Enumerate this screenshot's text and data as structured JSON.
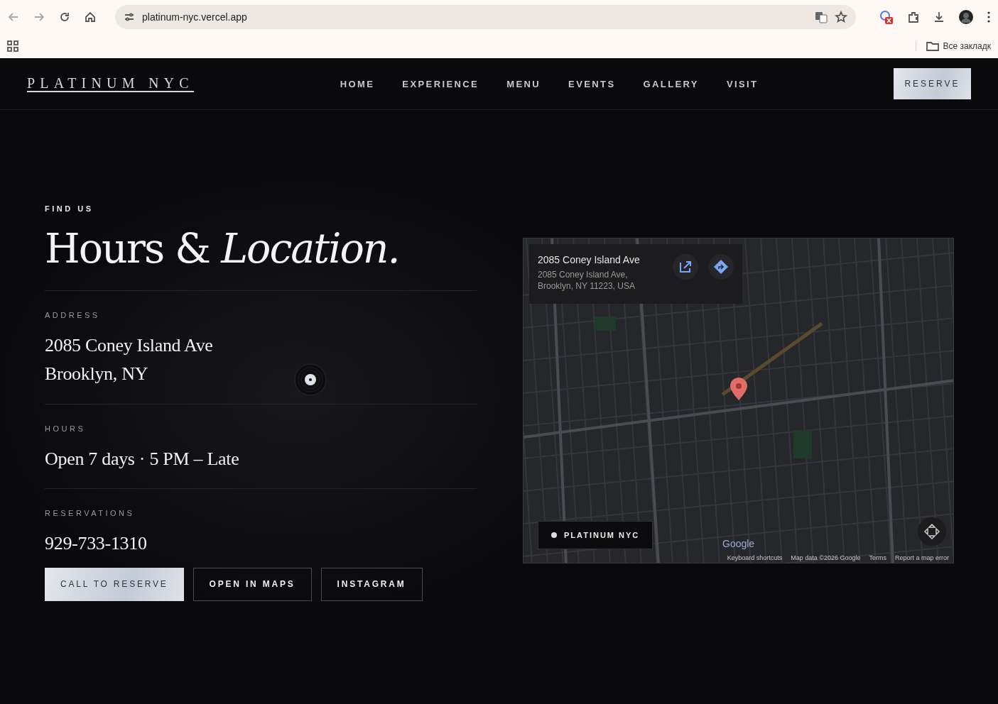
{
  "browser": {
    "url": "platinum-nyc.vercel.app",
    "bookmarks_label": "Все закладк"
  },
  "nav": {
    "logo": "PLATINUM NYC",
    "links": [
      {
        "label": "HOME"
      },
      {
        "label": "EXPERIENCE"
      },
      {
        "label": "MENU"
      },
      {
        "label": "EVENTS"
      },
      {
        "label": "GALLERY"
      },
      {
        "label": "VISIT"
      }
    ],
    "reserve": "RESERVE"
  },
  "section": {
    "eyebrow": "FIND US",
    "heading": "Hours & *Location.*",
    "blocks": [
      {
        "label": "ADDRESS",
        "lines": [
          "2085 Coney Island Ave",
          "Brooklyn, NY"
        ]
      },
      {
        "label": "HOURS",
        "lines": [
          "Open 7 days · 5 PM – Late"
        ]
      },
      {
        "label": "RESERVATIONS",
        "lines": [
          "929-733-1310"
        ]
      }
    ],
    "buttons": [
      {
        "label": "CALL TO RESERVE",
        "kind": "primary"
      },
      {
        "label": "OPEN IN MAPS",
        "kind": "outline"
      },
      {
        "label": "INSTAGRAM",
        "kind": "outline"
      }
    ]
  },
  "map": {
    "card": {
      "title": "2085 Coney Island Ave",
      "address_lines": [
        "2085 Coney Island Ave,",
        "Brooklyn, NY 11223, USA"
      ]
    },
    "badge": "PLATINUM NYC",
    "logo": "Google",
    "footer": [
      "Keyboard shortcuts",
      "Map data ©2026 Google",
      "Terms",
      "Report a map error"
    ]
  }
}
